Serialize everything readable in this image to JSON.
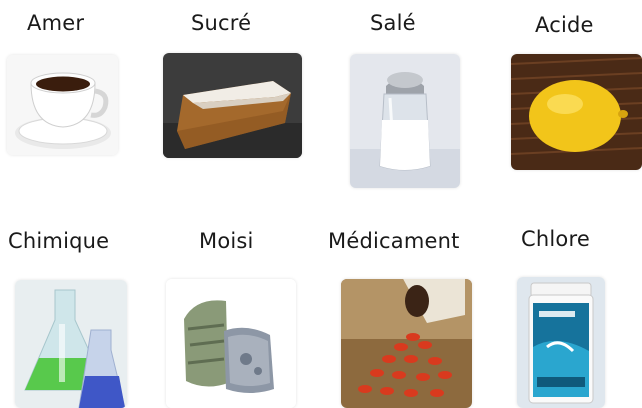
{
  "row1": {
    "amer": {
      "label": "Amer",
      "image": "coffee-cup-image"
    },
    "sucre": {
      "label": "Sucré",
      "image": "cake-slice-image"
    },
    "sale": {
      "label": "Salé",
      "image": "salt-shaker-image"
    },
    "acide": {
      "label": "Acide",
      "image": "lemon-image"
    }
  },
  "row2": {
    "chimique": {
      "label": "Chimique",
      "image": "lab-flasks-image"
    },
    "moisi": {
      "label": "Moisi",
      "image": "moldy-bread-image"
    },
    "medicament": {
      "label": "Médicament",
      "image": "pills-bottle-image"
    },
    "chlore": {
      "label": "Chlore",
      "image": "chlorine-tub-image"
    }
  }
}
